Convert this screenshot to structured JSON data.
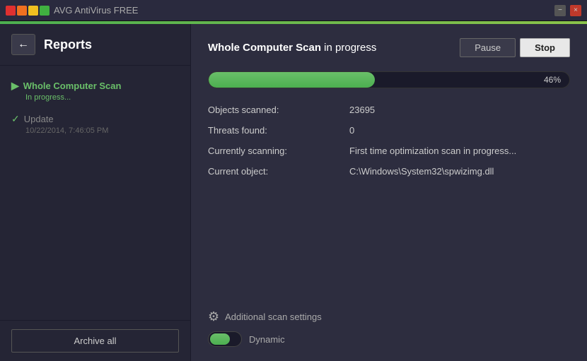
{
  "titleBar": {
    "appName": "AVG",
    "appNameSuffix": " AntiVirus FREE",
    "minimizeLabel": "−",
    "closeLabel": "×"
  },
  "sidebar": {
    "title": "Reports",
    "backArrow": "←",
    "items": [
      {
        "name": "whole-computer-scan",
        "title": "Whole Computer Scan",
        "status": "In progress...",
        "active": true,
        "iconType": "play"
      },
      {
        "name": "update",
        "title": "Update",
        "date": "10/22/2014, 7:46:05 PM",
        "active": false,
        "iconType": "check"
      }
    ],
    "archiveButton": "Archive all"
  },
  "mainContent": {
    "scanTitle": "Whole Computer Scan",
    "scanStatusLabel": " in progress",
    "pauseButton": "Pause",
    "stopButton": "Stop",
    "progressPercent": 46,
    "progressLabel": "46%",
    "stats": [
      {
        "label": "Objects scanned:",
        "value": "23695"
      },
      {
        "label": "Threats found:",
        "value": "0"
      },
      {
        "label": "Currently scanning:",
        "value": "First time optimization scan in progress..."
      },
      {
        "label": "Current object:",
        "value": "C:\\Windows\\System32\\spwizimg.dll"
      }
    ],
    "additionalSettingsLabel": "Additional scan settings",
    "toggleLabel": "Dynamic"
  }
}
